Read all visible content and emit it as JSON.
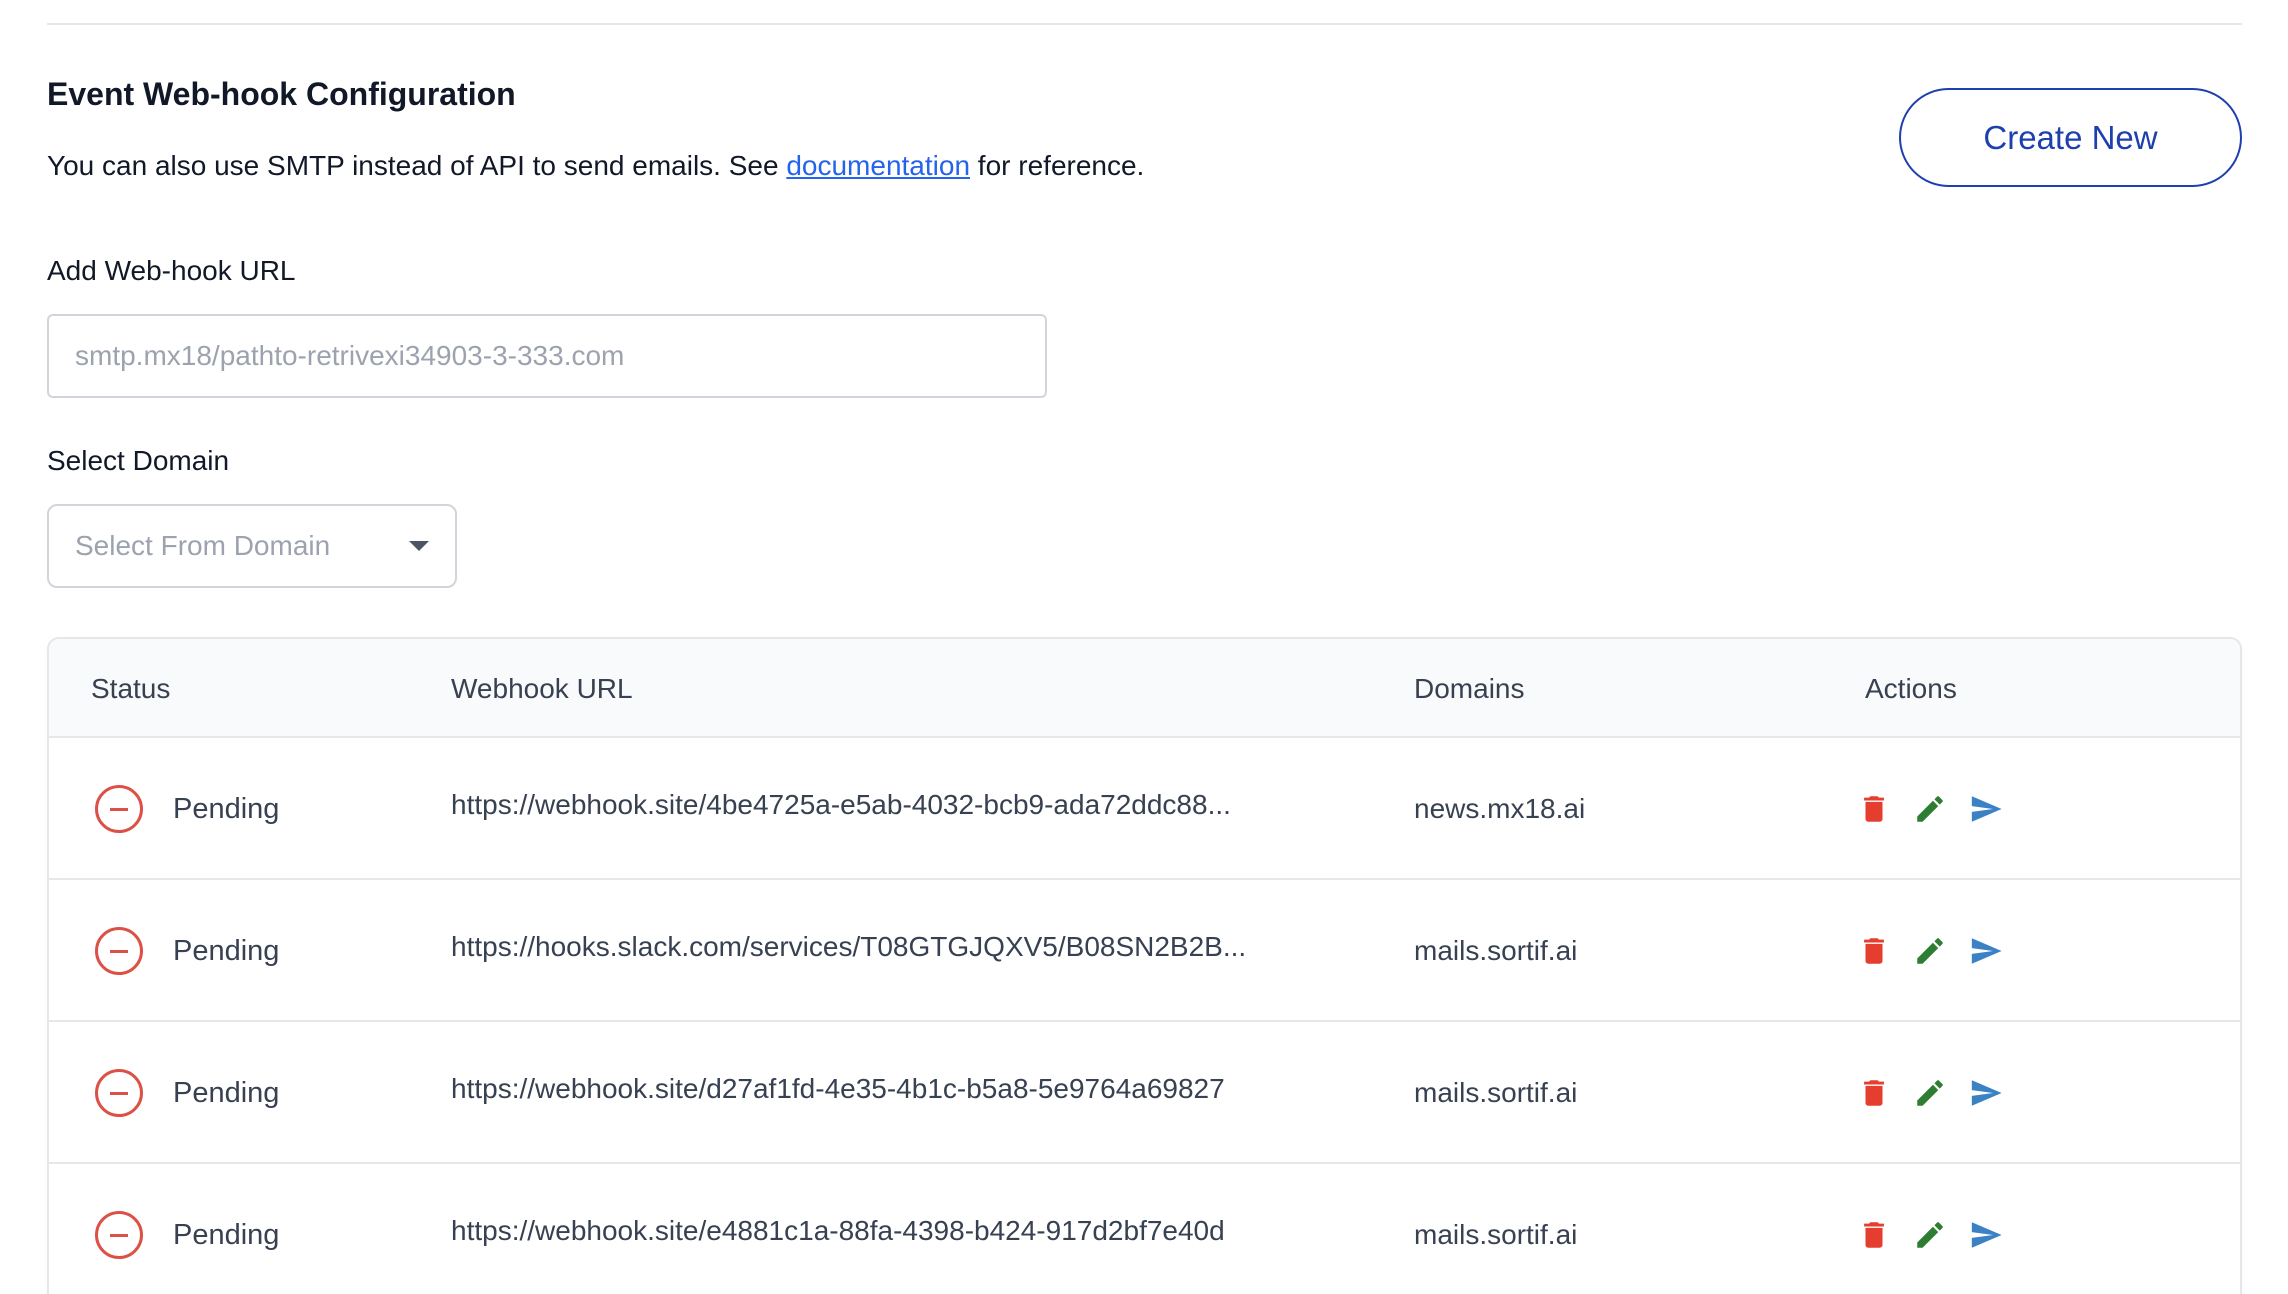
{
  "header": {
    "title": "Event Web-hook Configuration",
    "description_prefix": "You can also use SMTP instead of API to send emails. See ",
    "description_link": "documentation",
    "description_suffix": " for reference.",
    "create_button": "Create New"
  },
  "form": {
    "url_label": "Add Web-hook URL",
    "url_placeholder": "smtp.mx18/pathto-retrivexi34903-3-333.com",
    "domain_label": "Select Domain",
    "domain_placeholder": "Select From Domain"
  },
  "table": {
    "headers": {
      "status": "Status",
      "url": "Webhook URL",
      "domains": "Domains",
      "actions": "Actions"
    },
    "rows": [
      {
        "status": "Pending",
        "url": "https://webhook.site/4be4725a-e5ab-4032-bcb9-ada72ddc88...",
        "domain": "news.mx18.ai"
      },
      {
        "status": "Pending",
        "url": "https://hooks.slack.com/services/T08GTGJQXV5/B08SN2B2B...",
        "domain": "mails.sortif.ai"
      },
      {
        "status": "Pending",
        "url": "https://webhook.site/d27af1fd-4e35-4b1c-b5a8-5e9764a69827",
        "domain": "mails.sortif.ai"
      },
      {
        "status": "Pending",
        "url": "https://webhook.site/e4881c1a-88fa-4398-b424-917d2bf7e40d",
        "domain": "mails.sortif.ai"
      }
    ]
  },
  "icons": {
    "status": "minus-circle-icon",
    "delete": "trash-icon",
    "edit": "pencil-icon",
    "send": "send-icon"
  },
  "colors": {
    "accent": "#1e40af",
    "link": "#2563eb",
    "pending": "#dc5146",
    "delete": "#e53e2f",
    "edit": "#2e7d32",
    "send": "#3b82c4"
  }
}
